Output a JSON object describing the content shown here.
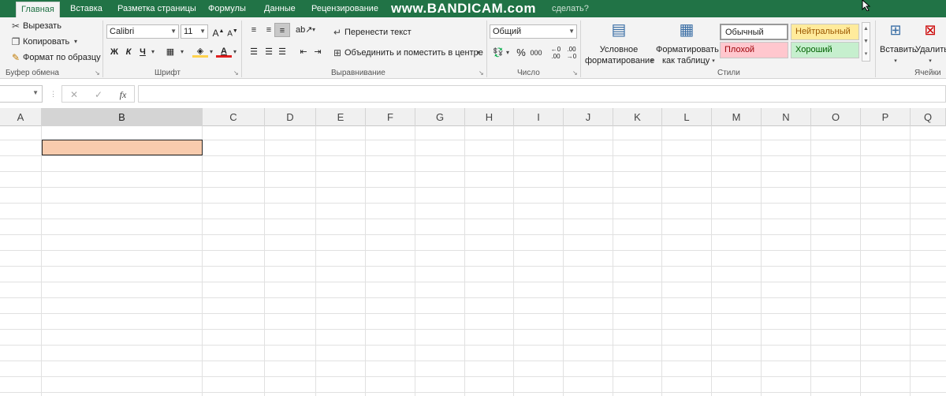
{
  "tabs": {
    "home": "Главная",
    "insert": "Вставка",
    "page_layout": "Разметка страницы",
    "formulas": "Формулы",
    "data": "Данные",
    "review": "Рецензирование",
    "tell_me": "сделать?"
  },
  "watermark": "www.BANDICAM.com",
  "clipboard": {
    "cut": "Вырезать",
    "copy": "Копировать",
    "format_painter": "Формат по образцу",
    "label": "Буфер обмена"
  },
  "font": {
    "name": "Calibri",
    "size": "11",
    "bold": "Ж",
    "italic": "К",
    "underline": "Ч",
    "label": "Шрифт"
  },
  "alignment": {
    "wrap_text": "Перенести текст",
    "merge_center": "Объединить и поместить в центре",
    "label": "Выравнивание"
  },
  "number": {
    "format": "Общий",
    "percent": "%",
    "thousands": "000",
    "label": "Число"
  },
  "styles": {
    "conditional_line1": "Условное",
    "conditional_line2": "форматирование",
    "format_table_line1": "Форматировать",
    "format_table_line2": "как таблицу",
    "normal": "Обычный",
    "neutral": "Нейтральный",
    "bad": "Плохой",
    "good": "Хороший",
    "label": "Стили"
  },
  "cells": {
    "insert": "Вставить",
    "delete": "Удалить",
    "label": "Ячейки"
  },
  "formula_bar": {
    "fx": "fx",
    "cancel": "✕",
    "enter": "✓"
  },
  "columns": [
    "A",
    "B",
    "C",
    "D",
    "E",
    "F",
    "G",
    "H",
    "I",
    "J",
    "K",
    "L",
    "M",
    "N",
    "O",
    "P",
    "Q"
  ],
  "selected_column": "B",
  "selected_cell_fill": "#f8cbad",
  "colors": {
    "accent": "#217346",
    "neutral_fill": "#ffeb9c",
    "bad_fill": "#ffc7ce",
    "good_fill": "#c6efce"
  }
}
